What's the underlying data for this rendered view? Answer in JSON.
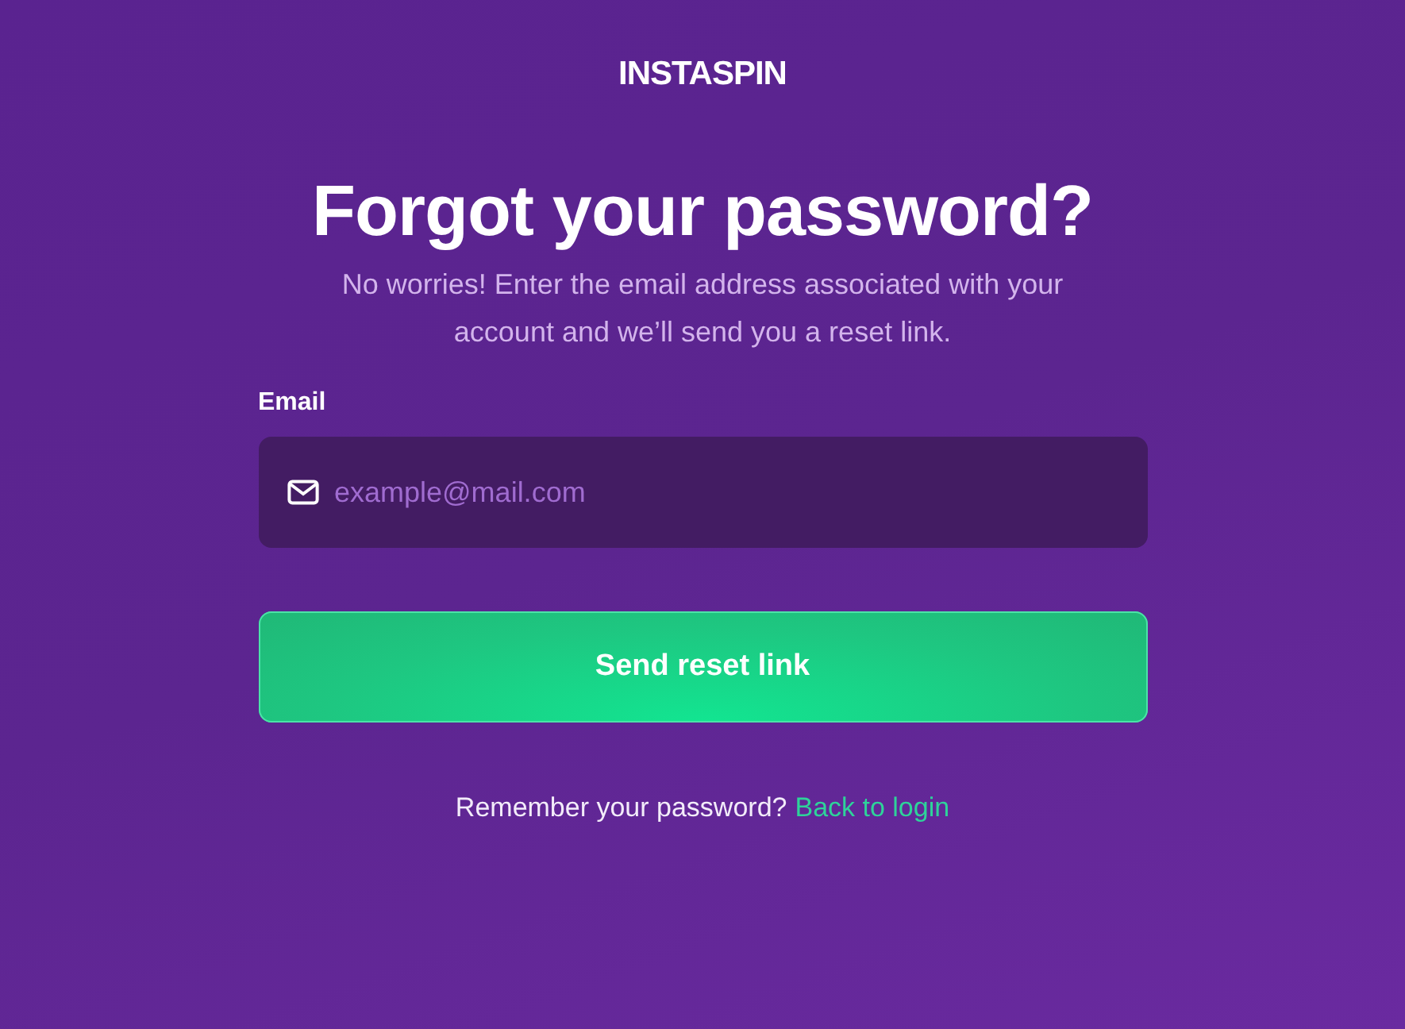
{
  "logo": "INSTASPIN",
  "title": "Forgot your password?",
  "subtitle": "No worries! Enter the email address associated with your account and we’ll send you a reset link.",
  "email_field": {
    "label": "Email",
    "placeholder": "example@mail.com"
  },
  "submit_button": "Send reset link",
  "footer": {
    "text": "Remember your password?",
    "link": "Back to login"
  }
}
